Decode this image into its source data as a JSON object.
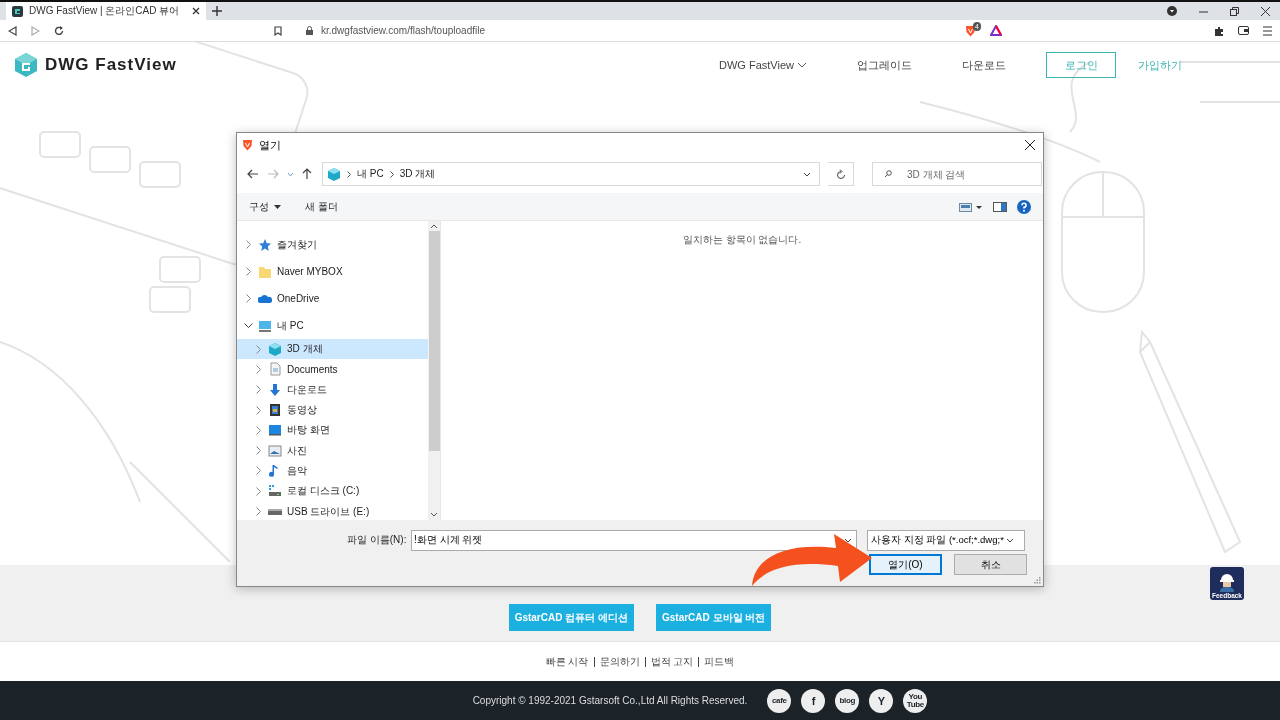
{
  "browser": {
    "tabs": [
      {
        "title": "DWG FastView | 온라인CAD 뷰어",
        "selected": true
      }
    ],
    "url": "kr.dwgfastview.com/flash/touploadfile",
    "shield_count": "4"
  },
  "site_header": {
    "logo_text": "DWG FastView",
    "nav": [
      {
        "label": "DWG FastView",
        "kind": "dropdown"
      },
      {
        "label": "업그레이드",
        "kind": "link"
      },
      {
        "label": "다운로드",
        "kind": "link"
      },
      {
        "label": "로그인",
        "kind": "outlined"
      },
      {
        "label": "가입하기",
        "kind": "accent"
      }
    ]
  },
  "dialog": {
    "title": "열기",
    "breadcrumb": [
      "내 PC",
      "3D 개체"
    ],
    "search": {
      "placeholder": "3D 개체 검색"
    },
    "toolbar": [
      {
        "label": "구성",
        "kind": "menu"
      },
      {
        "label": "새 폴더",
        "kind": "plain"
      }
    ],
    "tree": [
      {
        "label": "즐겨찾기",
        "kind": "star",
        "expanded": false,
        "selected": false
      },
      {
        "label": "Naver MYBOX",
        "kind": "folder",
        "expanded": false,
        "selected": false
      },
      {
        "label": "OneDrive",
        "kind": "cloud",
        "expanded": false,
        "selected": false
      },
      {
        "label": "내 PC",
        "kind": "pc",
        "expanded": true,
        "selected": false,
        "children": [
          {
            "label": "3D 개체",
            "kind": "cube",
            "expanded": false,
            "selected": true
          },
          {
            "label": "Documents",
            "kind": "doc",
            "expanded": false,
            "selected": false
          },
          {
            "label": "다운로드",
            "kind": "download",
            "expanded": false,
            "selected": false
          },
          {
            "label": "동영상",
            "kind": "video",
            "expanded": false,
            "selected": false
          },
          {
            "label": "바탕 화면",
            "kind": "desktop",
            "expanded": false,
            "selected": false
          },
          {
            "label": "사진",
            "kind": "photo",
            "expanded": false,
            "selected": false
          },
          {
            "label": "음악",
            "kind": "music",
            "expanded": false,
            "selected": false
          },
          {
            "label": "로컬 디스크 (C:)",
            "kind": "disk",
            "expanded": false,
            "selected": false
          },
          {
            "label": "USB 드라이브 (E:)",
            "kind": "usb",
            "expanded": false,
            "selected": false
          }
        ]
      }
    ],
    "empty_message": "일치하는 항목이 없습니다.",
    "file_name": {
      "label": "파일 이름(N):",
      "value": "!화면 시계 위젯"
    },
    "file_type": "사용자 지정 파일 (*.ocf;*.dwg;*",
    "buttons": [
      {
        "label": "열기(O)",
        "default": true
      },
      {
        "label": "취소",
        "default": false
      }
    ]
  },
  "download_buttons": [
    "GstarCAD 컴퓨터 에디션",
    "GstarCAD 모바일 버전"
  ],
  "footer_links": [
    "빠른 시작",
    "문의하기",
    "법적 고지",
    "피드백"
  ],
  "copyright": "Copyright © 1992-2021 Gstarsoft Co.,Ltd All Rights Reserved.",
  "social": [
    "cafe",
    "f",
    "blog",
    "Y",
    "You Tube"
  ],
  "feedback": "Feedback"
}
